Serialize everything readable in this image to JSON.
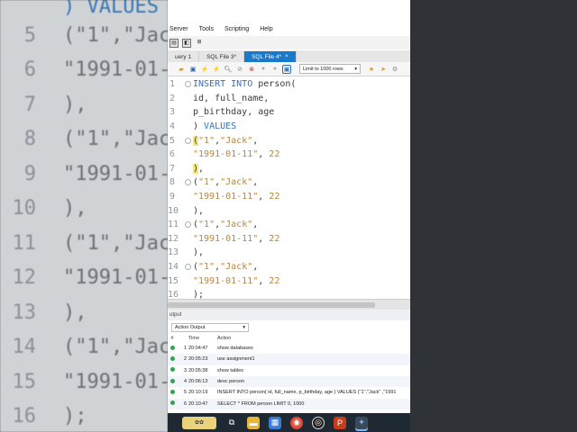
{
  "menubar": [
    "Server",
    "Tools",
    "Scripting",
    "Help"
  ],
  "tabs": [
    {
      "label": "uery 1",
      "active": false
    },
    {
      "label": "SQL File 3*",
      "active": false
    },
    {
      "label": "SQL File 4*",
      "active": true,
      "close": "×"
    }
  ],
  "toolbar2": {
    "limit_label": "Limit to 1000 rows",
    "limit_arrow": "▾"
  },
  "editor": {
    "lines": [
      {
        "n": "1",
        "fold": true,
        "parts": [
          [
            "kw",
            "INSERT INTO"
          ],
          [
            "t",
            " person("
          ]
        ]
      },
      {
        "n": "2",
        "fold": false,
        "parts": [
          [
            "t",
            "id, full_name,"
          ]
        ]
      },
      {
        "n": "3",
        "fold": false,
        "parts": [
          [
            "t",
            "p_birthday, age"
          ]
        ]
      },
      {
        "n": "4",
        "fold": false,
        "parts": [
          [
            "t",
            ") "
          ],
          [
            "kw",
            "VALUES"
          ]
        ]
      },
      {
        "n": "5",
        "fold": true,
        "parts": [
          [
            "hl",
            "("
          ],
          [
            "str",
            "\"1\""
          ],
          [
            "t",
            ","
          ],
          [
            "str",
            "\"Jack\""
          ],
          [
            "t",
            ","
          ]
        ]
      },
      {
        "n": "6",
        "fold": false,
        "parts": [
          [
            "str",
            "\"1991-01-11\""
          ],
          [
            "t",
            ", "
          ],
          [
            "str",
            "22"
          ]
        ]
      },
      {
        "n": "7",
        "fold": false,
        "parts": [
          [
            "hl",
            ")"
          ],
          [
            "t",
            ","
          ]
        ]
      },
      {
        "n": "8",
        "fold": true,
        "parts": [
          [
            "t",
            "("
          ],
          [
            "str",
            "\"1\""
          ],
          [
            "t",
            ","
          ],
          [
            "str",
            "\"Jack\""
          ],
          [
            "t",
            ","
          ]
        ]
      },
      {
        "n": "9",
        "fold": false,
        "parts": [
          [
            "str",
            "\"1991-01-11\""
          ],
          [
            "t",
            ", "
          ],
          [
            "str",
            "22"
          ]
        ]
      },
      {
        "n": "10",
        "fold": false,
        "parts": [
          [
            "t",
            "),"
          ]
        ]
      },
      {
        "n": "11",
        "fold": true,
        "parts": [
          [
            "t",
            "("
          ],
          [
            "str",
            "\"1\""
          ],
          [
            "t",
            ","
          ],
          [
            "str",
            "\"Jack\""
          ],
          [
            "t",
            ","
          ]
        ]
      },
      {
        "n": "12",
        "fold": false,
        "parts": [
          [
            "str",
            "\"1991-01-11\""
          ],
          [
            "t",
            ", "
          ],
          [
            "str",
            "22"
          ]
        ]
      },
      {
        "n": "13",
        "fold": false,
        "parts": [
          [
            "t",
            "),"
          ]
        ]
      },
      {
        "n": "14",
        "fold": true,
        "parts": [
          [
            "t",
            "("
          ],
          [
            "str",
            "\"1\""
          ],
          [
            "t",
            ","
          ],
          [
            "str",
            "\"Jack\""
          ],
          [
            "t",
            ","
          ]
        ]
      },
      {
        "n": "15",
        "fold": false,
        "parts": [
          [
            "str",
            "\"1991-01-11\""
          ],
          [
            "t",
            ", "
          ],
          [
            "str",
            "22"
          ]
        ]
      },
      {
        "n": "16",
        "fold": false,
        "parts": [
          [
            "t",
            ");"
          ]
        ]
      }
    ]
  },
  "output": {
    "header": "utput",
    "selector": "Action Output",
    "selector_arrow": "▾",
    "columns": [
      "#",
      "Time",
      "Action"
    ],
    "rows": [
      {
        "num": "1",
        "time": "20:04:47",
        "action": "show databases"
      },
      {
        "num": "2",
        "time": "20:05:23",
        "action": "use assignment1"
      },
      {
        "num": "3",
        "time": "20:05:38",
        "action": "show tables"
      },
      {
        "num": "4",
        "time": "20:06:13",
        "action": "desc person"
      },
      {
        "num": "5",
        "time": "20:10:19",
        "action": "INSERT INTO person( id, full_name, p_birthday, age ) VALUES (\"1\",\"Jack\" ,\"1991"
      },
      {
        "num": "6",
        "time": "20:10:47",
        "action": "SELECT * FROM person LIMIT 0, 1000"
      }
    ]
  },
  "background": {
    "left_lines": [
      {
        "n": "5",
        "text": "(\"1\",\"Jac"
      },
      {
        "n": "6",
        "text": "\"1991-01-"
      },
      {
        "n": "7",
        "text": "),"
      },
      {
        "n": "8",
        "text": "(\"1\",\"Jac"
      },
      {
        "n": "9",
        "text": "\"1991-01-"
      },
      {
        "n": "10",
        "text": "),"
      },
      {
        "n": "11",
        "text": "(\"1\",\"Jac"
      },
      {
        "n": "12",
        "text": "\"1991-01-"
      },
      {
        "n": "13",
        "text": "),"
      },
      {
        "n": "14",
        "text": "(\"1\",\"Jac"
      },
      {
        "n": "15",
        "text": "\"1991-01-"
      },
      {
        "n": "16",
        "text": ");"
      }
    ],
    "top_text": ") VALUES"
  },
  "colors": {
    "accent": "#1979ca",
    "keyword": "#2f72c4",
    "string": "#b9863e",
    "highlight": "#f5e77e"
  }
}
